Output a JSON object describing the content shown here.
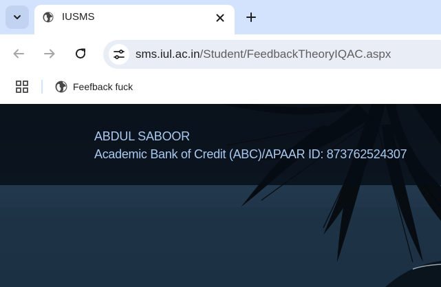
{
  "browser": {
    "tab": {
      "title": "IUSMS"
    },
    "address_bar": {
      "host": "sms.iul.ac.in",
      "path": "/Student/FeedbackTheoryIQAC.aspx"
    },
    "bookmarks": [
      {
        "label": "Feefback fuck"
      }
    ],
    "icons": {
      "tab_search": "chevron-down-icon",
      "favicon": "globe-icon",
      "close": "close-icon",
      "new_tab": "plus-icon",
      "back": "arrow-left-icon",
      "forward": "arrow-right-icon",
      "reload": "reload-icon",
      "site_info": "tune-icon",
      "apps": "apps-grid-icon"
    }
  },
  "page": {
    "student": {
      "name": "ABDUL SABOOR",
      "abc_line": "Academic Bank of Credit (ABC)/APAAR ID: 873762524307"
    }
  },
  "colors": {
    "tabstrip": "#d3e3fd",
    "omnibox": "#e9eef6",
    "student_text": "#a9c8ee"
  }
}
